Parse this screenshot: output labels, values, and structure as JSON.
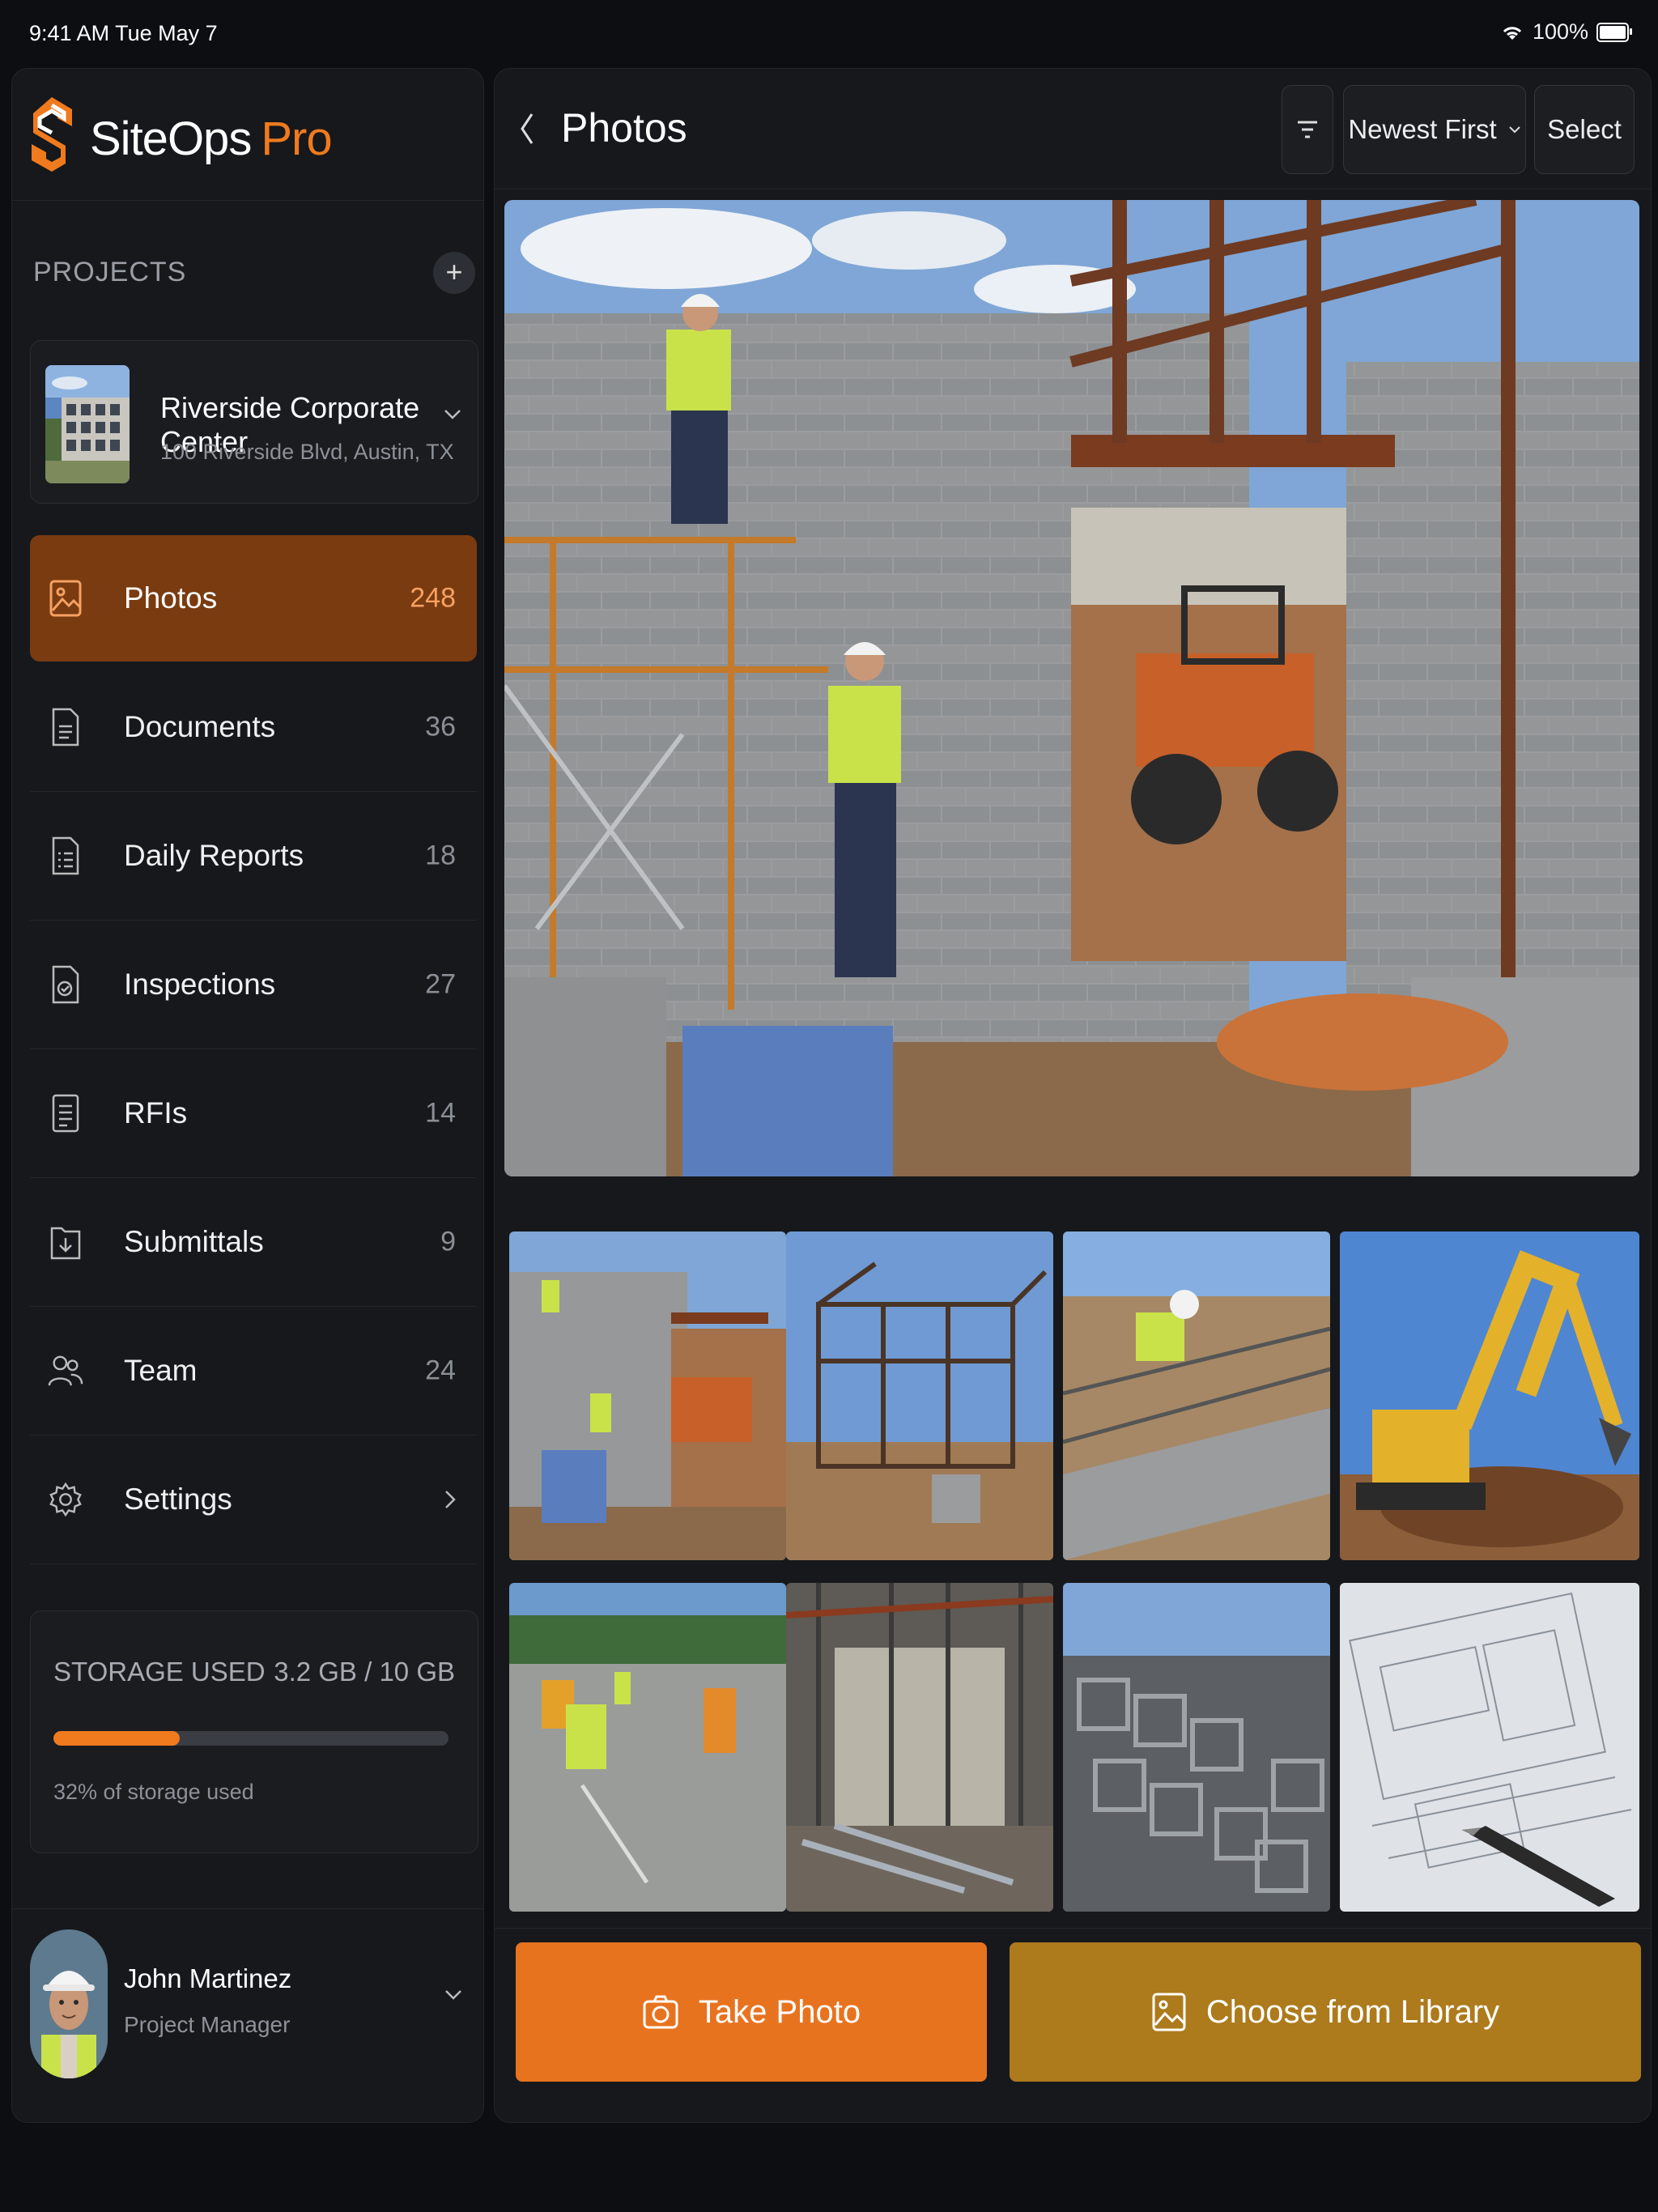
{
  "status_bar": {
    "time": "9:41 AM   Tue May 7",
    "battery": "100%",
    "battery_level": 1.0
  },
  "brand": {
    "name": "SiteOps",
    "accent": "Pro",
    "accent_color": "#f07a1e"
  },
  "projects": {
    "label": "PROJECTS",
    "add_symbol": "+",
    "current": {
      "name": "Riverside Corporate Center",
      "address": "100 Riverside Blvd, Austin, TX"
    }
  },
  "nav": {
    "items": [
      {
        "label": "Photos",
        "count": "248",
        "icon": "image-icon",
        "active": true
      },
      {
        "label": "Documents",
        "count": "36",
        "icon": "document-icon"
      },
      {
        "label": "Daily Reports",
        "count": "18",
        "icon": "report-icon"
      },
      {
        "label": "Inspections",
        "count": "27",
        "icon": "inspection-icon"
      },
      {
        "label": "RFIs",
        "count": "14",
        "icon": "rfi-icon"
      },
      {
        "label": "Submittals",
        "count": "9",
        "icon": "submittal-icon"
      },
      {
        "label": "Team",
        "count": "24",
        "icon": "team-icon"
      },
      {
        "label": "Settings",
        "count": "",
        "icon": "gear-icon"
      }
    ]
  },
  "storage": {
    "label": "STORAGE USED",
    "value": "3.2 GB / 10 GB",
    "fraction": 0.32,
    "caption": "32% of storage used"
  },
  "user": {
    "name": "John Martinez",
    "role": "Project Manager"
  },
  "header": {
    "title": "Photos",
    "sort_label": "Newest First",
    "select_label": "Select"
  },
  "actions": {
    "take_photo": "Take Photo",
    "choose_library": "Choose from Library"
  },
  "colors": {
    "accent": "#f07a1e",
    "active_nav": "#7a3b10",
    "take_photo_bg": "#e8731f",
    "library_bg": "#ad7a1c",
    "background": "#0c0e11"
  }
}
